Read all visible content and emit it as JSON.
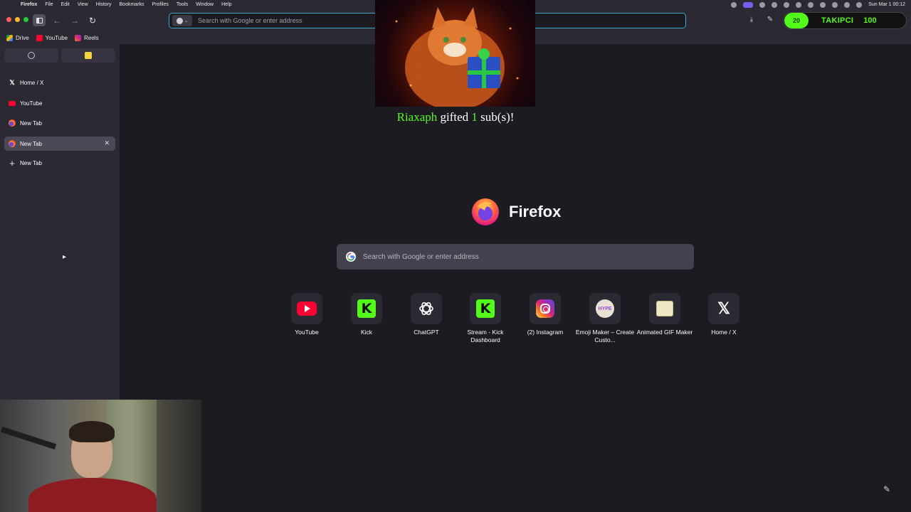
{
  "menubar": {
    "apple": "",
    "items": [
      "Firefox",
      "File",
      "Edit",
      "View",
      "History",
      "Bookmarks",
      "Profiles",
      "Tools",
      "Window",
      "Help"
    ],
    "clock": "Sun Mar 1  00:12"
  },
  "toolbar": {
    "url_placeholder": "Search with Google or enter address",
    "kick_widget": {
      "count": "20",
      "tag": "TAKIPCI",
      "number": "100"
    }
  },
  "bookmarks": [
    {
      "label": "Drive",
      "color": "#f4b400"
    },
    {
      "label": "YouTube",
      "color": "#ff0033"
    },
    {
      "label": "Reels",
      "color": "#d62976"
    }
  ],
  "sidebar": {
    "tabs": [
      {
        "label": "Home / X",
        "icon": "x-icon"
      },
      {
        "label": "YouTube",
        "icon": "youtube-icon"
      },
      {
        "label": "New Tab",
        "icon": "firefox-icon"
      },
      {
        "label": "New Tab",
        "icon": "firefox-icon",
        "active": true
      }
    ],
    "new_tab_label": "New Tab"
  },
  "alert": {
    "user": "Riaxaph",
    "mid": " gifted ",
    "count": "1",
    "end": " sub(s)!"
  },
  "newtab": {
    "brand": "Firefox",
    "search_placeholder": "Search with Google or enter address",
    "shortcuts": [
      {
        "label": "YouTube",
        "icon": "youtube-icon"
      },
      {
        "label": "Kick",
        "icon": "kick-icon"
      },
      {
        "label": "ChatGPT",
        "icon": "chatgpt-icon"
      },
      {
        "label": "Stream - Kick Dashboard",
        "icon": "kick-icon"
      },
      {
        "label": "(2) Instagram",
        "icon": "instagram-icon"
      },
      {
        "label": "Emoji Maker – Create Custo...",
        "icon": "emoji-maker-icon",
        "icon_text": "HYPE"
      },
      {
        "label": "Animated GIF Maker",
        "icon": "gif-maker-icon"
      },
      {
        "label": "Home / X",
        "icon": "x-icon"
      }
    ]
  },
  "colors": {
    "accent": "#3fa9c6",
    "kick_green": "#53fc18",
    "bg": "#1c1b22",
    "chrome": "#2b2a33"
  }
}
